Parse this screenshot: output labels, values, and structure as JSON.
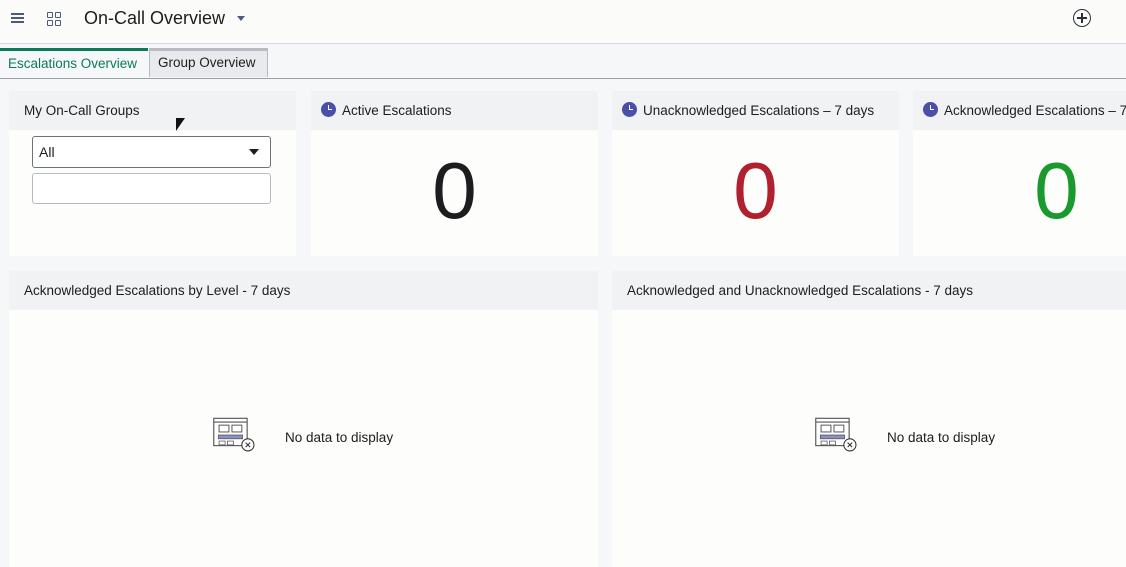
{
  "header": {
    "title": "On-Call Overview",
    "menu_icon": "menu-icon",
    "grid_icon": "grid-icon",
    "add_icon": "add-circle-icon"
  },
  "tabs": [
    {
      "label": "Escalations Overview",
      "active": true
    },
    {
      "label": "Group Overview",
      "active": false
    }
  ],
  "groups_card": {
    "title": "My On-Call Groups",
    "select_value": "All",
    "filter_value": ""
  },
  "metrics": [
    {
      "title": "Active Escalations",
      "value": "0",
      "color": "#1d1d1f",
      "icon": "clock-icon"
    },
    {
      "title": "Unacknowledged Escalations – 7 days",
      "value": "0",
      "color": "#b0202e",
      "icon": "clock-icon"
    },
    {
      "title": "Acknowledged Escalations – 7",
      "value": "0",
      "color": "#1a9a2c",
      "icon": "clock-icon"
    }
  ],
  "charts": [
    {
      "title": "Acknowledged Escalations by Level - 7 days",
      "empty_text": "No data to display"
    },
    {
      "title": "Acknowledged and Unacknowledged Escalations - 7 days",
      "empty_text": "No data to display"
    }
  ],
  "colors": {
    "accent": "#0c7a5a",
    "icon": "#4b4fa8"
  }
}
